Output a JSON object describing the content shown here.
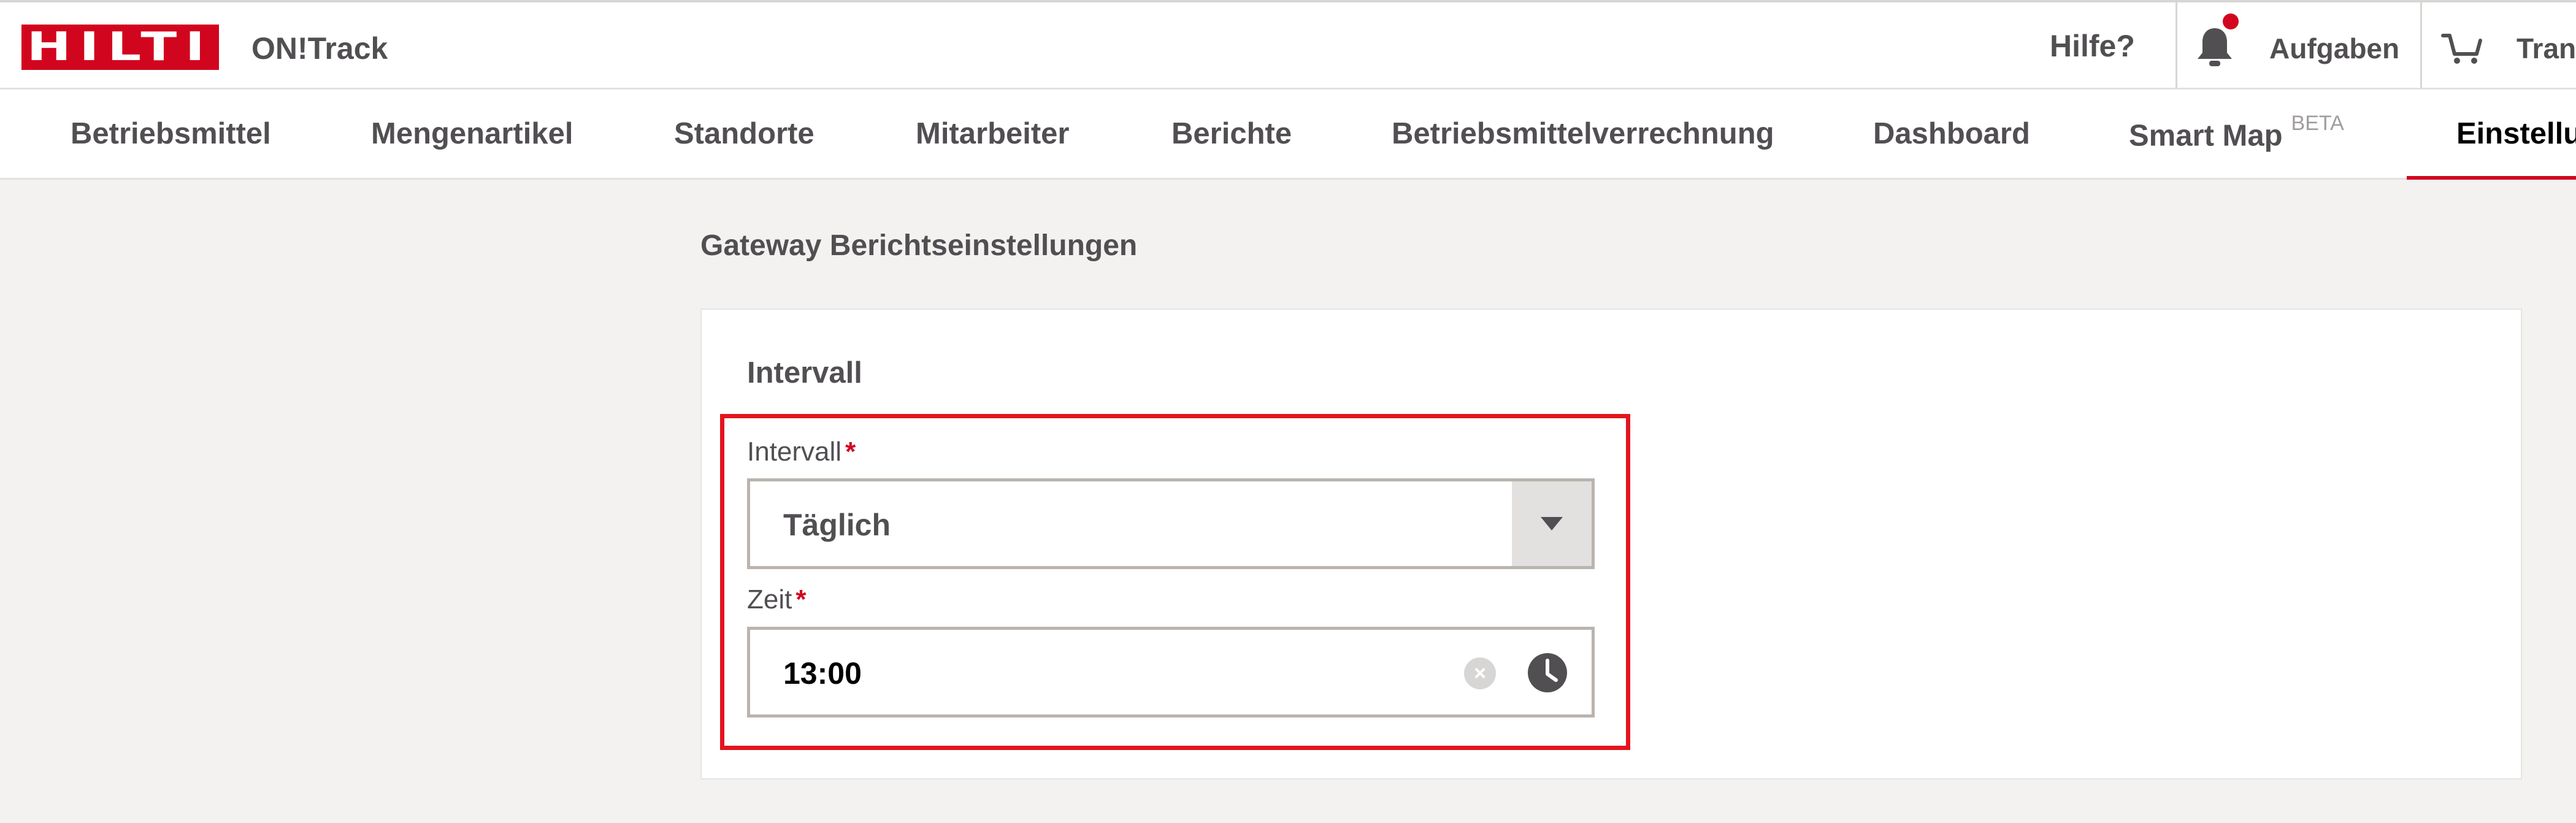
{
  "header": {
    "logo_text": "HILTI",
    "app_name": "ON!Track",
    "help": "Hilfe?",
    "tasks": "Aufgaben",
    "transfer": "Trans"
  },
  "nav": {
    "items": [
      {
        "label": "Betriebsmittel"
      },
      {
        "label": "Mengenartikel"
      },
      {
        "label": "Standorte"
      },
      {
        "label": "Mitarbeiter"
      },
      {
        "label": "Berichte"
      },
      {
        "label": "Betriebsmittelverrechnung"
      },
      {
        "label": "Dashboard"
      },
      {
        "label": "Smart Map",
        "badge": "BETA"
      },
      {
        "label": "Einstellu",
        "active": true
      }
    ]
  },
  "page": {
    "title": "Gateway Berichtseinstellungen"
  },
  "interval_card": {
    "section_title": "Intervall",
    "interval_field": {
      "label": "Intervall",
      "required_mark": "*",
      "value": "Täglich"
    },
    "time_field": {
      "label": "Zeit",
      "required_mark": "*",
      "value": "13:00"
    }
  },
  "colors": {
    "brand_red": "#d2051e",
    "highlight_border": "#e3141d",
    "text": "#524f53",
    "background": "#f3f2f0"
  },
  "icons": [
    "bell-icon",
    "notification-dot",
    "cart-icon",
    "chevron-down-icon",
    "clear-icon",
    "clock-icon"
  ]
}
